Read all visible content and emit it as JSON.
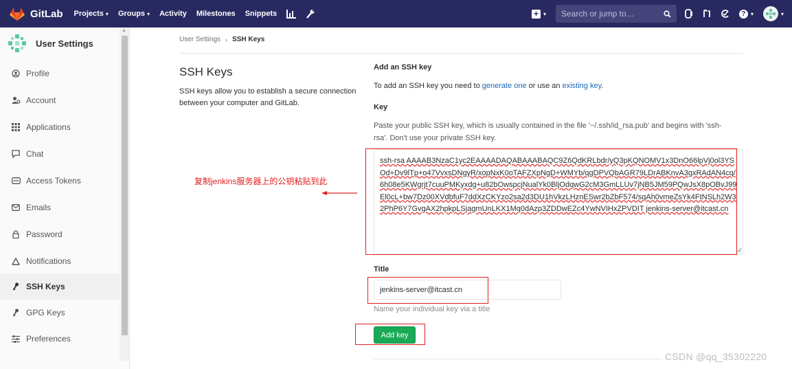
{
  "navbar": {
    "brand": "GitLab",
    "items": [
      {
        "label": "Projects",
        "dropdown": true
      },
      {
        "label": "Groups",
        "dropdown": true
      },
      {
        "label": "Activity",
        "dropdown": false
      },
      {
        "label": "Milestones",
        "dropdown": false
      },
      {
        "label": "Snippets",
        "dropdown": false
      }
    ],
    "icons": [
      "chart-icon",
      "wrench-icon"
    ],
    "search_placeholder": "Search or jump to…",
    "right_icons": [
      "search-icon",
      "issues-icon",
      "merge-request-icon",
      "todo-icon",
      "help-icon",
      "avatar"
    ],
    "bg_color": "#292961"
  },
  "sidebar": {
    "title": "User Settings",
    "items": [
      {
        "label": "Profile",
        "icon": "profile-icon"
      },
      {
        "label": "Account",
        "icon": "account-icon"
      },
      {
        "label": "Applications",
        "icon": "applications-icon"
      },
      {
        "label": "Chat",
        "icon": "chat-icon"
      },
      {
        "label": "Access Tokens",
        "icon": "token-icon"
      },
      {
        "label": "Emails",
        "icon": "email-icon"
      },
      {
        "label": "Password",
        "icon": "lock-icon"
      },
      {
        "label": "Notifications",
        "icon": "bell-icon"
      },
      {
        "label": "SSH Keys",
        "icon": "key-icon",
        "active": true
      },
      {
        "label": "GPG Keys",
        "icon": "key-icon"
      },
      {
        "label": "Preferences",
        "icon": "sliders-icon"
      }
    ]
  },
  "breadcrumb": {
    "parent": "User Settings",
    "separator": "›",
    "current": "SSH Keys"
  },
  "intro": {
    "title": "SSH Keys",
    "description": "SSH keys allow you to establish a secure connection between your computer and GitLab."
  },
  "form": {
    "add_heading": "Add an SSH key",
    "add_text_before": "To add an SSH key you need to ",
    "generate_link": "generate one",
    "add_text_middle": " or use an ",
    "existing_link": "existing key",
    "add_text_after": ".",
    "key_label": "Key",
    "key_help": "Paste your public SSH key, which is usually contained in the file '~/.ssh/id_rsa.pub' and begins with 'ssh-rsa'. Don't use your private SSH key.",
    "key_value": "ssh-rsa AAAAB3NzaC1yc2EAAAADAQABAAABAQC9Z6QdKRLbdr/yQ3pKQNOMV1x3DnO66lpVj0ol3YSOd+Dv9lTp+o47VvxsDNgyR/xopNxK0oTAFZXpNgD+WMYb/qgDPVQbAGR79LDrABKnvA3gxRAdAN4cq/6h08e5KWgrjt7cuuPMKyxdg+u82bOwspcjNualYk0BljOdqwG2cM3GmLLUv7jNB5JM59PQwJsX8pOBvJ99El0cL+bw7Dz00XVdbfuF7ddXzCKYzo2sa2d3DU1hVkzLHznESwr2bZbF574/sqAh0vmeZsYk4FtNSLh2W32PhP6Y7GvgAX2hpkpLSjagmUnLKX1Mq0dAzp3ZDDwEZc4YwNVIHxZPVDIT jenkins-server@itcast.cn",
    "title_label": "Title",
    "title_value": "jenkins-server@itcast.cn",
    "title_help": "Name your individual key via a title",
    "submit_label": "Add key"
  },
  "annotation": {
    "text": "复制jenkins服务器上的公钥粘贴到此",
    "color": "#e02020"
  },
  "watermark": "CSDN @qq_35302220",
  "colors": {
    "primary_button": "#1aaa55",
    "link": "#1b69b6",
    "highlight_box": "#e02020"
  }
}
